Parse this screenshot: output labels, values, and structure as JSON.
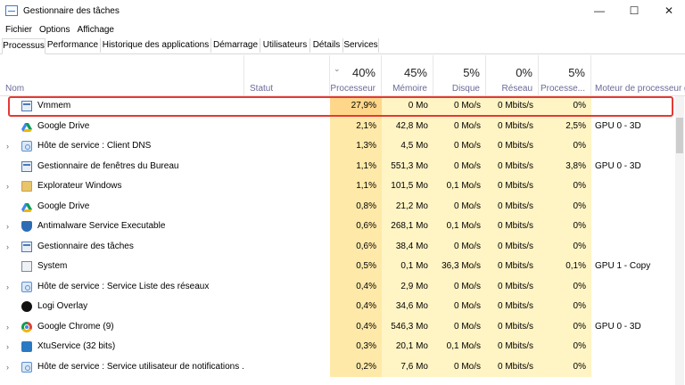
{
  "window": {
    "title": "Gestionnaire des tâches",
    "controls": [
      "—",
      "☐",
      "✕"
    ]
  },
  "menu": [
    "Fichier",
    "Options",
    "Affichage"
  ],
  "tabs": [
    "Processus",
    "Performance",
    "Historique des applications",
    "Démarrage",
    "Utilisateurs",
    "Détails",
    "Services"
  ],
  "active_tab": "Processus",
  "columns": {
    "name": "Nom",
    "status": "Statut",
    "cpu": {
      "pct": "40%",
      "label": "Processeur"
    },
    "memory": {
      "pct": "45%",
      "label": "Mémoire"
    },
    "disk": {
      "pct": "5%",
      "label": "Disque"
    },
    "network": {
      "pct": "0%",
      "label": "Réseau"
    },
    "gpu": {
      "pct": "5%",
      "label": "Processe..."
    },
    "gpu_engine": {
      "label": "Moteur de processeur g"
    }
  },
  "processes": [
    {
      "name": "Vmmem",
      "expandable": false,
      "icon": "exe-icon",
      "cpu": "27,9%",
      "memory": "0 Mo",
      "disk": "0 Mo/s",
      "network": "0 Mbits/s",
      "gpu": "0%",
      "gpu_engine": ""
    },
    {
      "name": "Google Drive",
      "expandable": false,
      "icon": "drive-icon",
      "cpu": "2,1%",
      "memory": "42,8 Mo",
      "disk": "0 Mo/s",
      "network": "0 Mbits/s",
      "gpu": "2,5%",
      "gpu_engine": "GPU 0 - 3D"
    },
    {
      "name": "Hôte de service : Client DNS",
      "expandable": true,
      "icon": "gear-icon",
      "cpu": "1,3%",
      "memory": "4,5 Mo",
      "disk": "0 Mo/s",
      "network": "0 Mbits/s",
      "gpu": "0%",
      "gpu_engine": ""
    },
    {
      "name": "Gestionnaire de fenêtres du Bureau",
      "expandable": false,
      "icon": "exe-icon",
      "cpu": "1,1%",
      "memory": "551,3 Mo",
      "disk": "0 Mo/s",
      "network": "0 Mbits/s",
      "gpu": "3,8%",
      "gpu_engine": "GPU 0 - 3D"
    },
    {
      "name": "Explorateur Windows",
      "expandable": true,
      "icon": "folder-icon",
      "cpu": "1,1%",
      "memory": "101,5 Mo",
      "disk": "0,1 Mo/s",
      "network": "0 Mbits/s",
      "gpu": "0%",
      "gpu_engine": ""
    },
    {
      "name": "Google Drive",
      "expandable": false,
      "icon": "drive-icon",
      "cpu": "0,8%",
      "memory": "21,2 Mo",
      "disk": "0 Mo/s",
      "network": "0 Mbits/s",
      "gpu": "0%",
      "gpu_engine": ""
    },
    {
      "name": "Antimalware Service Executable",
      "expandable": true,
      "icon": "shield-icon",
      "cpu": "0,6%",
      "memory": "268,1 Mo",
      "disk": "0,1 Mo/s",
      "network": "0 Mbits/s",
      "gpu": "0%",
      "gpu_engine": ""
    },
    {
      "name": "Gestionnaire des tâches",
      "expandable": true,
      "icon": "taskmgr-icon",
      "cpu": "0,6%",
      "memory": "38,4 Mo",
      "disk": "0 Mo/s",
      "network": "0 Mbits/s",
      "gpu": "0%",
      "gpu_engine": ""
    },
    {
      "name": "System",
      "expandable": false,
      "icon": "system-icon",
      "cpu": "0,5%",
      "memory": "0,1 Mo",
      "disk": "36,3 Mo/s",
      "network": "0 Mbits/s",
      "gpu": "0,1%",
      "gpu_engine": "GPU 1 - Copy"
    },
    {
      "name": "Hôte de service : Service Liste des réseaux",
      "expandable": true,
      "icon": "gear-icon",
      "cpu": "0,4%",
      "memory": "2,9 Mo",
      "disk": "0 Mo/s",
      "network": "0 Mbits/s",
      "gpu": "0%",
      "gpu_engine": ""
    },
    {
      "name": "Logi Overlay",
      "expandable": false,
      "icon": "logi-icon",
      "cpu": "0,4%",
      "memory": "34,6 Mo",
      "disk": "0 Mo/s",
      "network": "0 Mbits/s",
      "gpu": "0%",
      "gpu_engine": ""
    },
    {
      "name": "Google Chrome (9)",
      "expandable": true,
      "icon": "chrome-icon",
      "cpu": "0,4%",
      "memory": "546,3 Mo",
      "disk": "0 Mo/s",
      "network": "0 Mbits/s",
      "gpu": "0%",
      "gpu_engine": "GPU 0 - 3D"
    },
    {
      "name": "XtuService (32 bits)",
      "expandable": true,
      "icon": "xtu-icon",
      "cpu": "0,3%",
      "memory": "20,1 Mo",
      "disk": "0,1 Mo/s",
      "network": "0 Mbits/s",
      "gpu": "0%",
      "gpu_engine": ""
    },
    {
      "name": "Hôte de service : Service utilisateur de notifications ...",
      "expandable": true,
      "icon": "gear-icon",
      "cpu": "0,2%",
      "memory": "7,6 Mo",
      "disk": "0 Mo/s",
      "network": "0 Mbits/s",
      "gpu": "0%",
      "gpu_engine": ""
    }
  ],
  "colors": {
    "highlight_border": "#e53935",
    "cell_light": "#fff4c4",
    "cell_hot": "#ffd78a"
  }
}
